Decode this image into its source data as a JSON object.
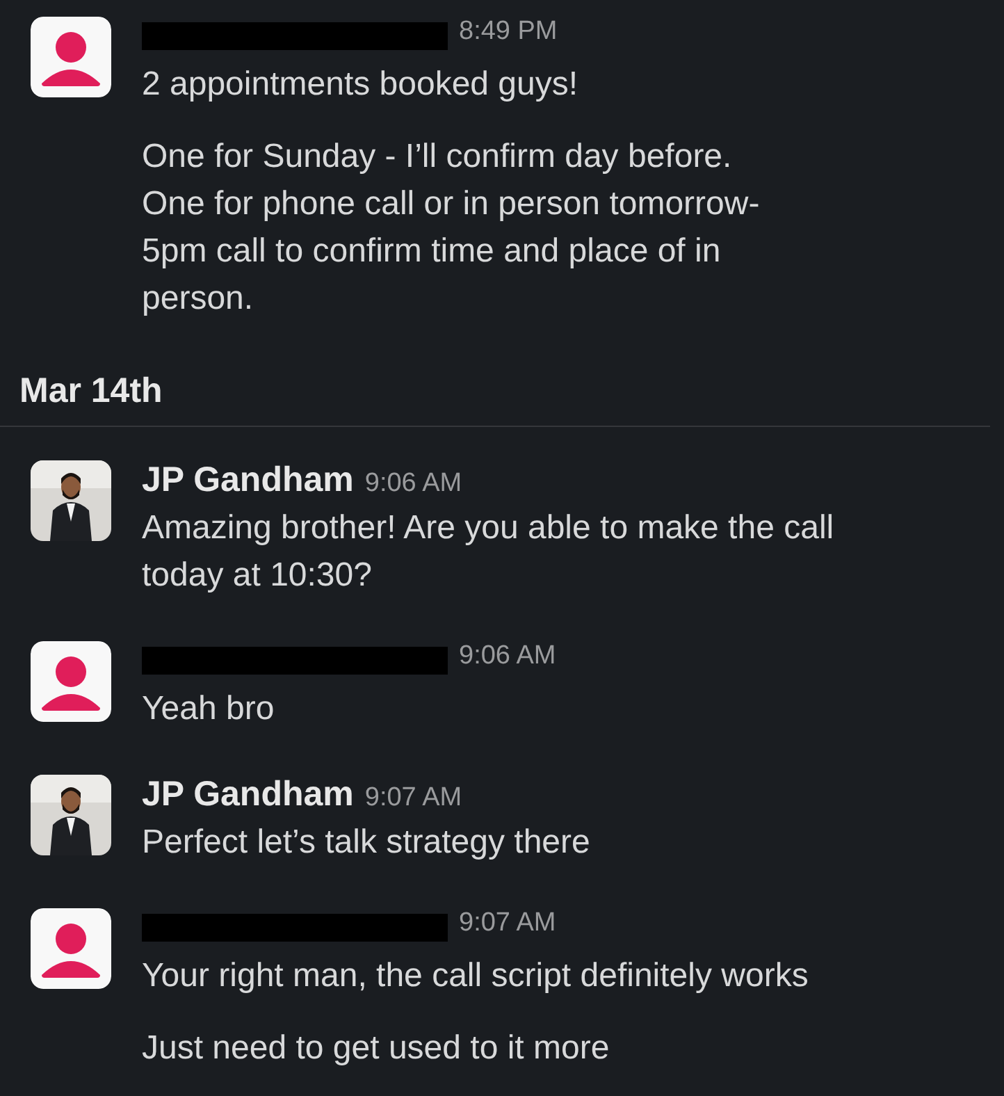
{
  "messages": [
    {
      "avatar": {
        "kind": "default"
      },
      "redacted": true,
      "time": "8:49 PM",
      "paragraphs": [
        "2 appointments booked guys!",
        "One for Sunday - I’ll confirm day before.\nOne for phone call or in person tomorrow-\n5pm call to confirm time and place of in\nperson."
      ]
    },
    {
      "kind": "divider",
      "label": "Mar 14th"
    },
    {
      "avatar": {
        "kind": "picture"
      },
      "name": "JP Gandham",
      "time": "9:06 AM",
      "paragraphs": [
        "Amazing brother! Are you able to make the call\ntoday at 10:30?"
      ]
    },
    {
      "avatar": {
        "kind": "default"
      },
      "redacted": true,
      "time": "9:06 AM",
      "paragraphs": [
        "Yeah bro"
      ]
    },
    {
      "avatar": {
        "kind": "picture"
      },
      "name": "JP Gandham",
      "time": "9:07 AM",
      "paragraphs": [
        "Perfect let’s talk strategy there"
      ]
    },
    {
      "avatar": {
        "kind": "default"
      },
      "redacted": true,
      "time": "9:07 AM",
      "paragraphs": [
        "Your right man, the call script definitely works",
        "Just need to get used to it more"
      ]
    }
  ]
}
